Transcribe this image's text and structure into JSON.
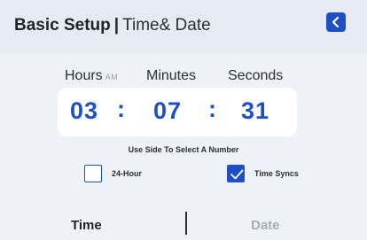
{
  "header": {
    "title": "Basic Setup",
    "separator": "|",
    "subtitle": "Time& Date",
    "back_icon": "chevron-left-icon"
  },
  "time": {
    "hours_label": "Hours",
    "ampm_label": "AM",
    "minutes_label": "Minutes",
    "seconds_label": "Seconds",
    "hours": "03",
    "minutes": "07",
    "seconds": "31",
    "separator": ":"
  },
  "hint": "Use Side To Select A Number",
  "options": {
    "hour24": {
      "label": "24-Hour",
      "checked": false
    },
    "time_syncs": {
      "label": "Time Syncs",
      "checked": true
    }
  },
  "tabs": {
    "time": "Time",
    "date": "Date"
  },
  "colors": {
    "accent": "#1e4fc4",
    "background": "#eef1f8",
    "inactive_tab": "#a8adb6"
  }
}
